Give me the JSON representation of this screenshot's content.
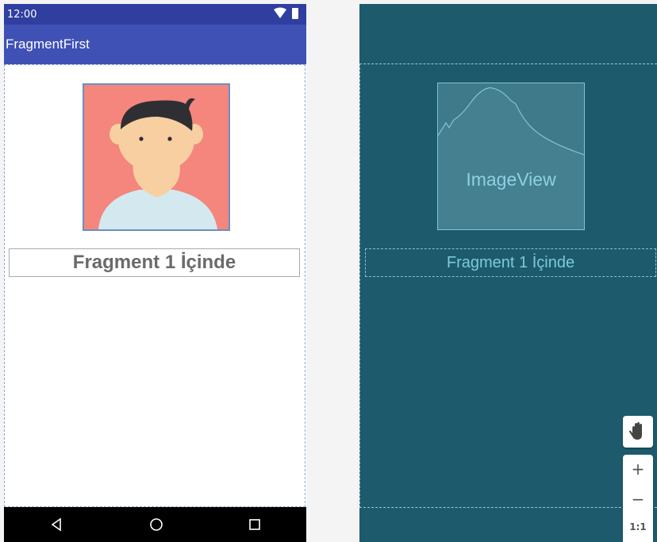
{
  "status_bar": {
    "time": "12:00"
  },
  "app_bar": {
    "title": "FragmentFirst"
  },
  "design": {
    "fragment_text": "Fragment 1 İçinde"
  },
  "blueprint": {
    "image_label": "ImageView",
    "fragment_text": "Fragment 1 İçinde"
  },
  "zoom_controls": {
    "zoom_in": "+",
    "zoom_out": "−",
    "actual_size": "1:1"
  },
  "icons": {
    "status": [
      "wifi-icon",
      "battery-icon"
    ],
    "nav": [
      "back-icon",
      "home-icon",
      "recents-icon"
    ],
    "tools": [
      "pan-hand-icon"
    ]
  },
  "colors": {
    "status_bar": "#303f9f",
    "app_bar": "#3f51b5",
    "avatar_background": "#f4867d",
    "blueprint_background": "#1d5b6c",
    "blueprint_accent": "#7ec8dc"
  }
}
